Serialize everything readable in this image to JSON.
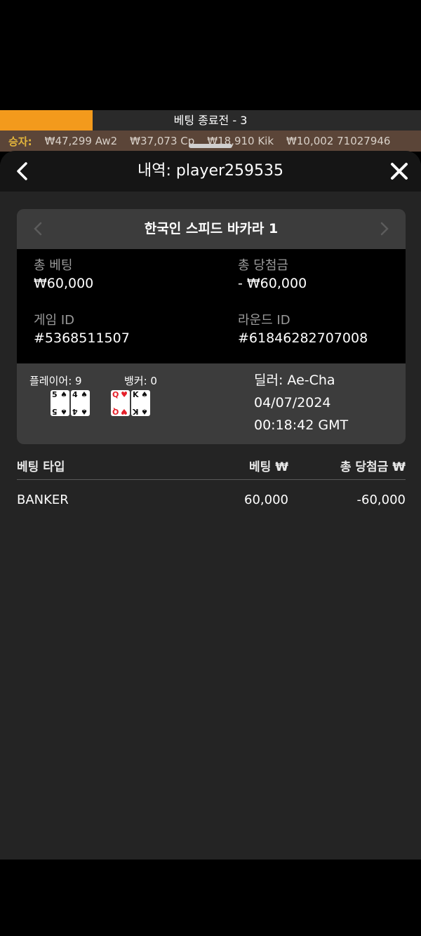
{
  "topbar": {
    "label": "베팅 종료전 - 3",
    "progress_fraction": 0.22,
    "fill_color": "#f39a1c"
  },
  "winners": {
    "title": "승자:",
    "items": [
      "₩47,299 Aw2",
      "₩37,073 Cp",
      "₩18,910 Kik",
      "₩10,002 71027946"
    ]
  },
  "header": {
    "title": "내역: player259535",
    "back_icon": "chevron-left-icon",
    "close_icon": "close-icon"
  },
  "game": {
    "name": "한국인 스피드 바카라 1",
    "total_bet_label": "총 베팅",
    "total_bet_value": "₩60,000",
    "total_win_label": "총 당첨금",
    "total_win_value": "- ₩60,000",
    "game_id_label": "게임 ID",
    "game_id_value": "#5368511507",
    "round_id_label": "라운드 ID",
    "round_id_value": "#61846282707008"
  },
  "result": {
    "player_label": "플레이어: 9",
    "banker_label": "뱅커: 0",
    "player_cards": [
      {
        "rank": "5",
        "suit": "♠",
        "color": "black"
      },
      {
        "rank": "4",
        "suit": "♠",
        "color": "black"
      }
    ],
    "banker_cards": [
      {
        "rank": "Q",
        "suit": "♥",
        "color": "red"
      },
      {
        "rank": "K",
        "suit": "♠",
        "color": "black"
      }
    ],
    "dealer": "딜러: Ae-Cha",
    "date": "04/07/2024",
    "time": "00:18:42 GMT"
  },
  "bets_table": {
    "headers": [
      "베팅 타입",
      "베팅 ₩",
      "총 당첨금 ₩"
    ],
    "rows": [
      [
        "BANKER",
        "60,000",
        "-60,000"
      ]
    ]
  }
}
